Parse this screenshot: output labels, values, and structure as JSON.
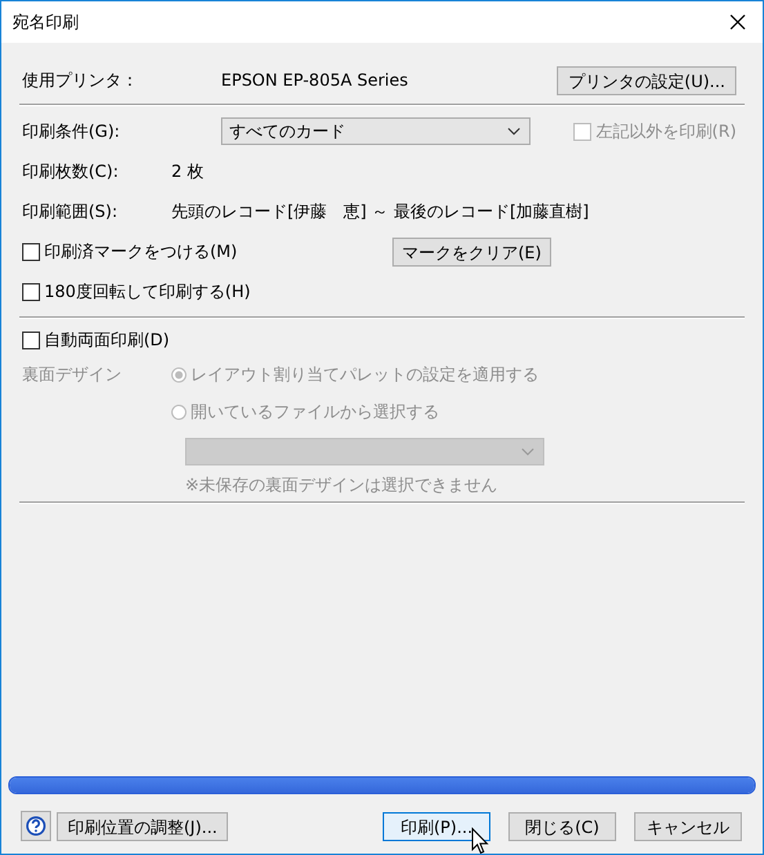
{
  "window": {
    "title": "宛名印刷"
  },
  "printer": {
    "label": "使用プリンタ：",
    "name": "EPSON EP-805A Series",
    "button": "プリンタの設定(U)..."
  },
  "condition": {
    "label": "印刷条件(G):",
    "value": "すべてのカード",
    "exclude": {
      "label": "左記以外を印刷(R)",
      "checked": false,
      "disabled": true
    }
  },
  "count": {
    "label": "印刷枚数(C):",
    "value": "2 枚"
  },
  "range": {
    "label": "印刷範囲(S):",
    "value": "先頭のレコード[伊藤　恵] ～ 最後のレコード[加藤直樹]"
  },
  "options": [
    {
      "label": "印刷済マークをつける(M)",
      "checked": false,
      "button": "マークをクリア(E)"
    },
    {
      "label": "180度回転して印刷する(H)",
      "checked": false
    }
  ],
  "duplex": {
    "label": "自動両面印刷(D)",
    "checked": false,
    "back_design": {
      "label": "裏面デザイン",
      "disabled": true,
      "choices": [
        {
          "label": "レイアウト割り当てパレットの設定を適用する",
          "selected": true
        },
        {
          "label": "開いているファイルから選択する",
          "selected": false
        }
      ],
      "note": "※未保存の裏面デザインは選択できません"
    }
  },
  "progress": {
    "level": 1
  },
  "left_buttons": [
    {
      "label": "印刷位置の調整(J)...",
      "hovered": false
    }
  ],
  "buttons": [
    {
      "label": "印刷(P)...",
      "hovered": true
    },
    {
      "label": "閉じる(C)",
      "hovered": false
    },
    {
      "label": "キャンセル",
      "hovered": false
    }
  ]
}
